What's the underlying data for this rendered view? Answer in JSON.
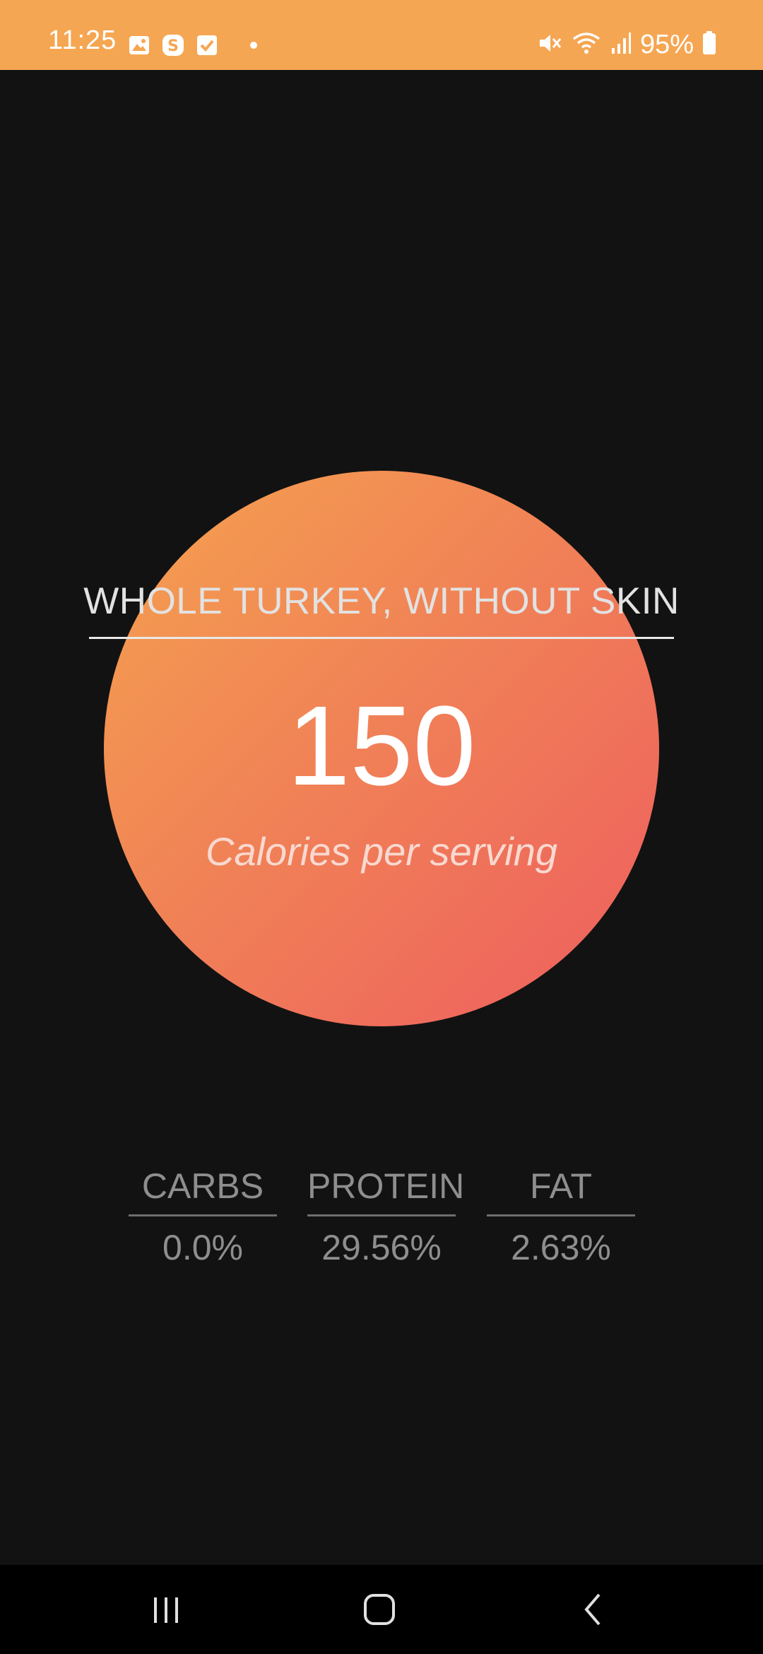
{
  "status_bar": {
    "time": "11:25",
    "battery": "95%",
    "background_color": "#F5A652",
    "left_icons": [
      "gallery-icon",
      "skype-icon",
      "checkbox-icon",
      "dot-icon"
    ],
    "right_icons": [
      "mute-icon",
      "wifi-icon",
      "signal-icon",
      "battery-icon"
    ]
  },
  "food": {
    "name": "WHOLE TURKEY, WITHOUT SKIN",
    "calories": "150",
    "calories_label": "Calories per serving"
  },
  "macros": [
    {
      "label": "CARBS",
      "value": "0.0%"
    },
    {
      "label": "PROTEIN",
      "value": "29.56%"
    },
    {
      "label": "FAT",
      "value": "2.63%"
    }
  ],
  "nav_bar": {
    "buttons": [
      "recents-icon",
      "home-icon",
      "back-icon"
    ]
  }
}
